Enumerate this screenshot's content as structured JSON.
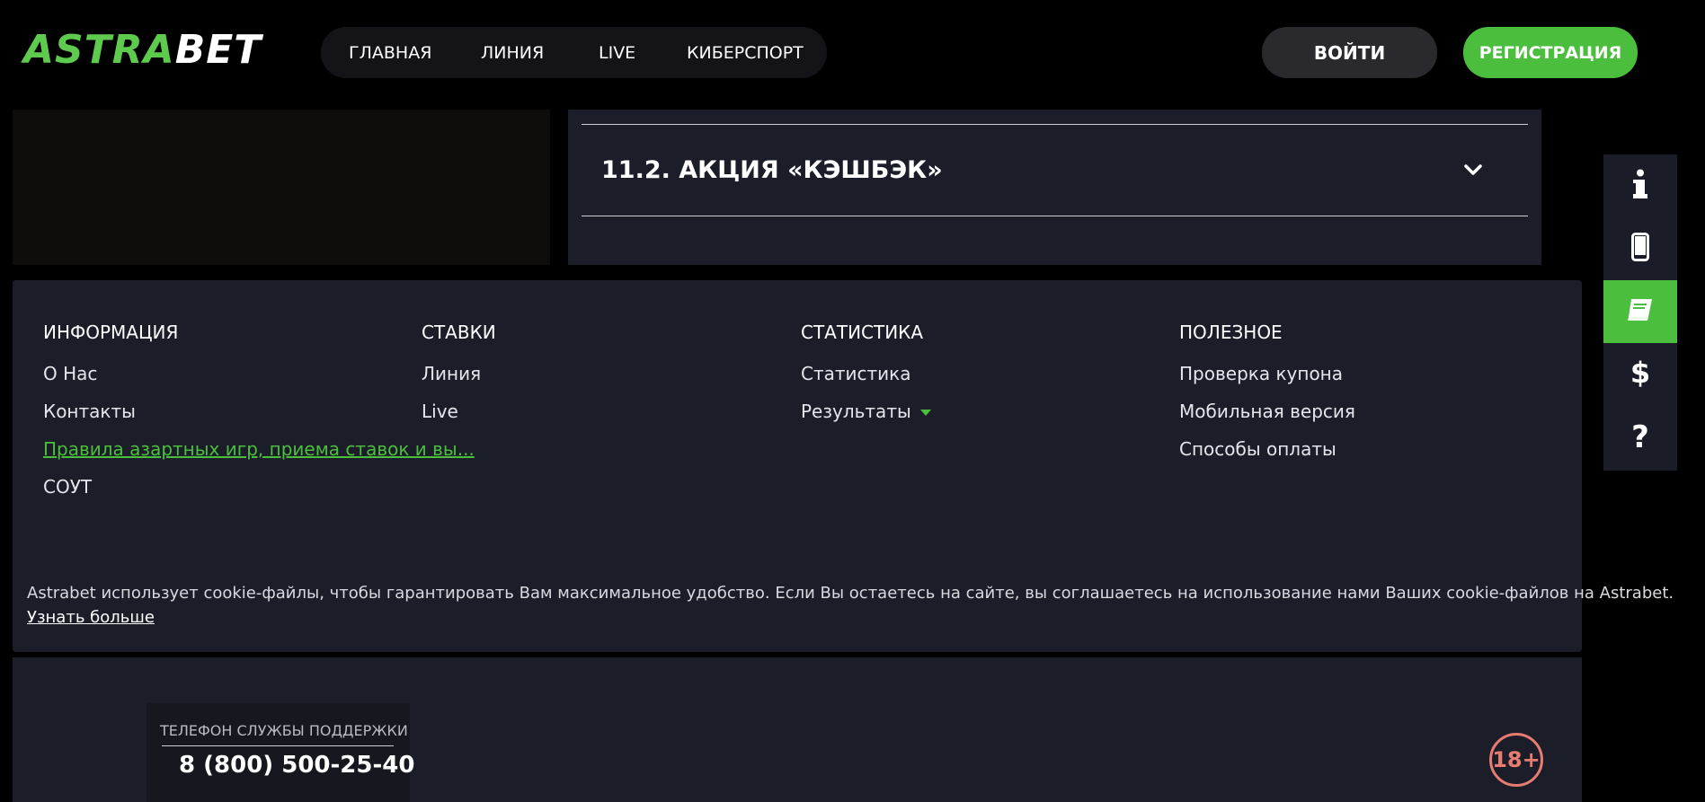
{
  "header": {
    "logo_part1": "ASTRA",
    "logo_part2": "BET",
    "nav": [
      "ГЛАВНАЯ",
      "ЛИНИЯ",
      "LIVE",
      "КИБЕРСПОРТ"
    ],
    "login_label": "ВОЙТИ",
    "register_label": "РЕГИСТРАЦИЯ"
  },
  "accordion": {
    "title": "11.2. АКЦИЯ «КЭШБЭК»"
  },
  "rail": {
    "icons": [
      "info-icon",
      "mobile-phone-icon",
      "book-icon",
      "dollar-icon",
      "question-icon"
    ],
    "active_index": 2
  },
  "footer": {
    "columns": [
      {
        "heading": "ИНФОРМАЦИЯ",
        "links": [
          "О Нас",
          "Контакты",
          "Правила азартных игр, приема ставок и вы...",
          "СОУТ"
        ]
      },
      {
        "heading": "СТАВКИ",
        "links": [
          "Линия",
          "Live"
        ]
      },
      {
        "heading": "СТАТИСТИКА",
        "links": [
          "Статистика",
          "Результаты"
        ]
      },
      {
        "heading": "ПОЛЕЗНОЕ",
        "links": [
          "Проверка купона",
          "Мобильная версия",
          "Способы оплаты"
        ]
      }
    ],
    "cookie_text": "Astrabet использует cookie-файлы, чтобы гарантировать Вам максимальное удобство. Если Вы остаетесь на сайте, вы соглашаетесь на использование нами Ваших cookie-файлов на Astrabet.",
    "cookie_link": "Узнать больше",
    "support_label": "ТЕЛЕФОН СЛУЖБЫ ПОДДЕРЖКИ",
    "support_phone": "8 (800) 500-25-40",
    "age_badge": "18+"
  },
  "colors": {
    "accent_green": "#4bbf3d",
    "panel": "#1b1d29",
    "age_badge": "#e77c73"
  }
}
